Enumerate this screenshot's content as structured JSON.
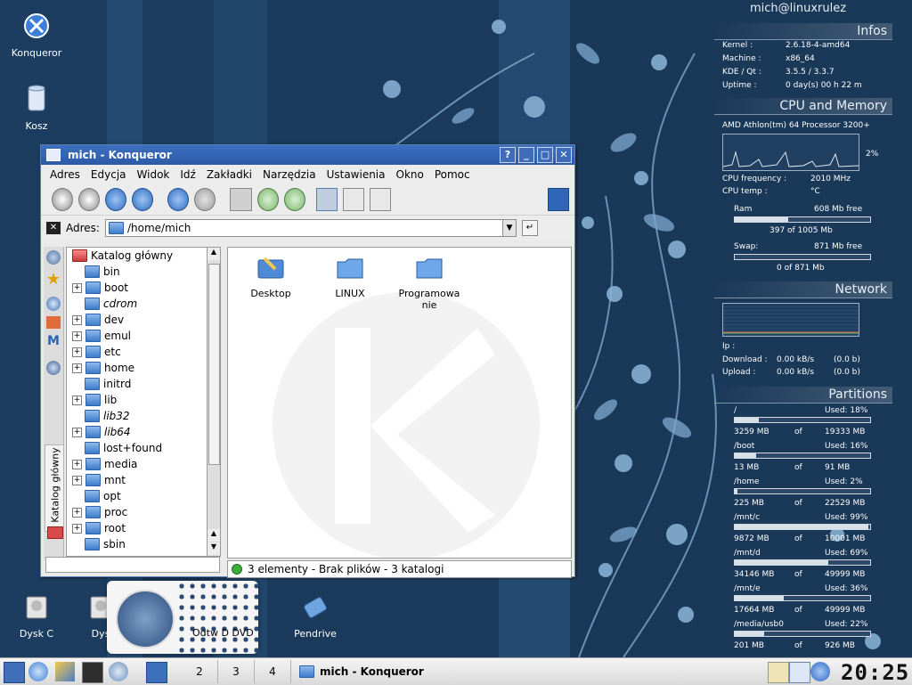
{
  "desktop": {
    "icons": [
      {
        "label": "Konqueror"
      },
      {
        "label": "Kosz"
      },
      {
        "label": "Dysk C"
      },
      {
        "label": "Dys"
      },
      {
        "label": "Pendrive"
      }
    ],
    "dock_label": "Odtw D DVD"
  },
  "window": {
    "title": "mich - Konqueror",
    "buttons": {
      "help": "?",
      "min": "_",
      "max": "□",
      "close": "✕"
    },
    "menu": [
      "Adres",
      "Edycja",
      "Widok",
      "Idź",
      "Zakładki",
      "Narzędzia",
      "Ustawienia",
      "Okno",
      "Pomoc"
    ],
    "location": {
      "label": "Adres:",
      "value": "/home/mich"
    },
    "sidebar_tab": "Katalog główny",
    "tree": [
      {
        "name": "Katalog główny",
        "expander": "",
        "root": true
      },
      {
        "name": "bin",
        "expander": ""
      },
      {
        "name": "boot",
        "expander": "+"
      },
      {
        "name": "cdrom",
        "expander": "",
        "italic": true
      },
      {
        "name": "dev",
        "expander": "+"
      },
      {
        "name": "emul",
        "expander": "+"
      },
      {
        "name": "etc",
        "expander": "+"
      },
      {
        "name": "home",
        "expander": "+"
      },
      {
        "name": "initrd",
        "expander": ""
      },
      {
        "name": "lib",
        "expander": "+"
      },
      {
        "name": "lib32",
        "expander": "",
        "italic": true
      },
      {
        "name": "lib64",
        "expander": "+",
        "italic": true
      },
      {
        "name": "lost+found",
        "expander": ""
      },
      {
        "name": "media",
        "expander": "+"
      },
      {
        "name": "mnt",
        "expander": "+"
      },
      {
        "name": "opt",
        "expander": ""
      },
      {
        "name": "proc",
        "expander": "+"
      },
      {
        "name": "root",
        "expander": "+"
      },
      {
        "name": "sbin",
        "expander": ""
      }
    ],
    "files": [
      {
        "name": "Desktop"
      },
      {
        "name": "LINUX"
      },
      {
        "name": "Programowa nie"
      }
    ],
    "status": "3 elementy - Brak plików - 3 katalogi"
  },
  "monitor": {
    "user": "mich@linuxrulez",
    "infos_title": "Infos",
    "infos": [
      {
        "k": "Kernel :",
        "v": "2.6.18-4-amd64"
      },
      {
        "k": "Machine :",
        "v": "x86_64"
      },
      {
        "k": "KDE / Qt :",
        "v": "3.5.5     /     3.3.7"
      },
      {
        "k": "Uptime :",
        "v": "0 day(s)   00 h 22 m"
      }
    ],
    "cpu_title": "CPU and Memory",
    "cpu_name": "AMD Athlon(tm) 64 Processor 3200+",
    "cpu_percent": "2%",
    "cpu_freq_label": "CPU frequency :",
    "cpu_freq": "2010 MHz",
    "cpu_temp_label": "CPU temp :",
    "cpu_temp": "°C",
    "ram_label": "Ram",
    "ram_free": "608 Mb free",
    "ram_used": "397 of 1005 Mb",
    "ram_fraction": 0.395,
    "swap_label": "Swap:",
    "swap_free": "871 Mb free",
    "swap_used": "0 of 871 Mb",
    "swap_fraction": 0.0,
    "net_title": "Network",
    "ip_label": "Ip :",
    "download_label": "Download :",
    "download": "0.00 kB/s",
    "download_total": "(0.0 b)",
    "upload_label": "Upload :",
    "upload": "0.00 kB/s",
    "upload_total": "(0.0 b)",
    "part_title": "Partitions",
    "of": "of",
    "partitions": [
      {
        "mount": "/",
        "used": "Used: 18%",
        "u": "3259 MB",
        "t": "19333 MB",
        "pct": 0.18
      },
      {
        "mount": "/boot",
        "used": "Used: 16%",
        "u": "13 MB",
        "t": "91 MB",
        "pct": 0.16
      },
      {
        "mount": "/home",
        "used": "Used: 2%",
        "u": "225 MB",
        "t": "22529 MB",
        "pct": 0.02
      },
      {
        "mount": "/mnt/c",
        "used": "Used: 99%",
        "u": "9872 MB",
        "t": "10001 MB",
        "pct": 0.99
      },
      {
        "mount": "/mnt/d",
        "used": "Used: 69%",
        "u": "34146 MB",
        "t": "49999 MB",
        "pct": 0.69
      },
      {
        "mount": "/mnt/e",
        "used": "Used: 36%",
        "u": "17664 MB",
        "t": "49999 MB",
        "pct": 0.36
      },
      {
        "mount": "/media/usb0",
        "used": "Used: 22%",
        "u": "201 MB",
        "t": "926 MB",
        "pct": 0.22
      }
    ]
  },
  "taskbar": {
    "desktops": [
      "2",
      "3",
      "4"
    ],
    "task": "mich - Konqueror",
    "clock": "20:25"
  }
}
